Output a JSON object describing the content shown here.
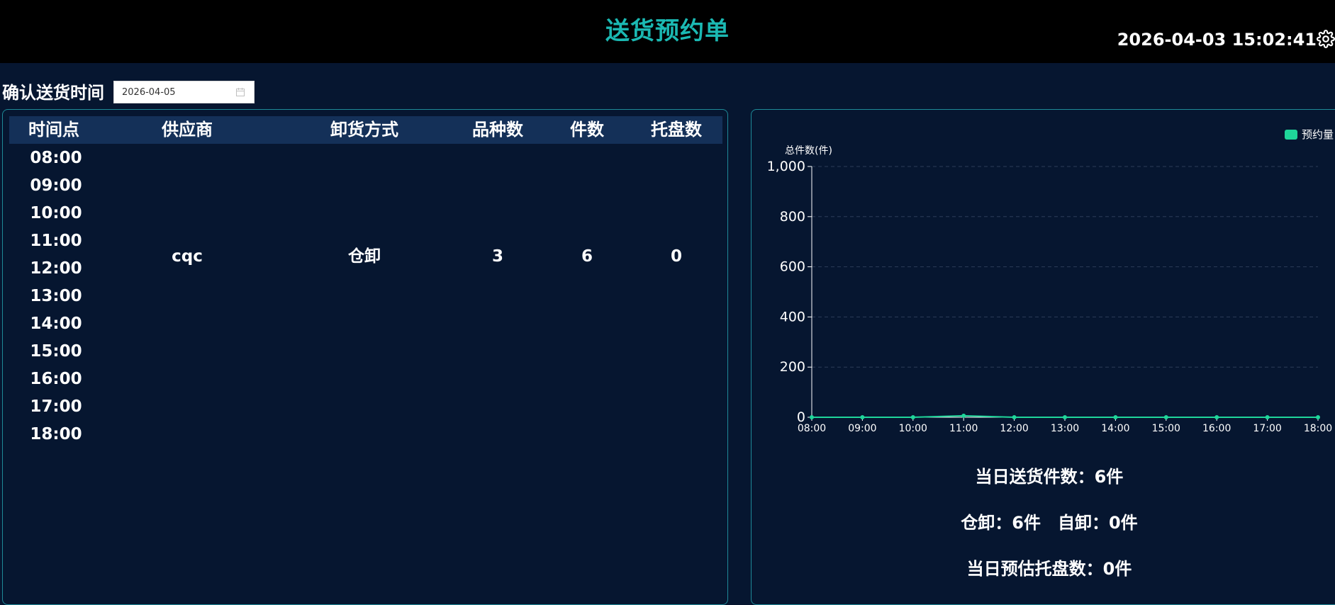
{
  "header": {
    "title": "送货预约单",
    "datetime": "2026-04-03 15:02:41"
  },
  "filter": {
    "label": "确认送货时间",
    "date_value": "2026-04-05"
  },
  "table": {
    "columns": [
      "时间点",
      "供应商",
      "卸货方式",
      "品种数",
      "件数",
      "托盘数"
    ],
    "times": [
      "08:00",
      "09:00",
      "10:00",
      "11:00",
      "12:00",
      "13:00",
      "14:00",
      "15:00",
      "16:00",
      "17:00",
      "18:00"
    ],
    "rows": [
      {
        "time": "11:00",
        "supplier": "cqc",
        "unload": "仓卸",
        "varieties": "3",
        "pieces": "6",
        "pallets": "0"
      }
    ]
  },
  "chart_data": {
    "type": "line",
    "ylabel": "总件数(件)",
    "x": [
      "08:00",
      "09:00",
      "10:00",
      "11:00",
      "12:00",
      "13:00",
      "14:00",
      "15:00",
      "16:00",
      "17:00",
      "18:00"
    ],
    "series": [
      {
        "name": "预约量",
        "values": [
          0,
          0,
          0,
          6,
          0,
          0,
          0,
          0,
          0,
          0,
          0
        ]
      }
    ],
    "ylim": [
      0,
      1000
    ],
    "yticks": [
      "0",
      "200",
      "400",
      "600",
      "800",
      "1,000"
    ],
    "grid": true,
    "legend_position": "top-right",
    "line_color": "#1fd69a"
  },
  "summary": {
    "total_pieces": "当日送货件数：6件",
    "warehouse_unload": "仓卸：6件",
    "self_unload": "自卸：0件",
    "pallets_estimate": "当日预估托盘数：0件"
  }
}
